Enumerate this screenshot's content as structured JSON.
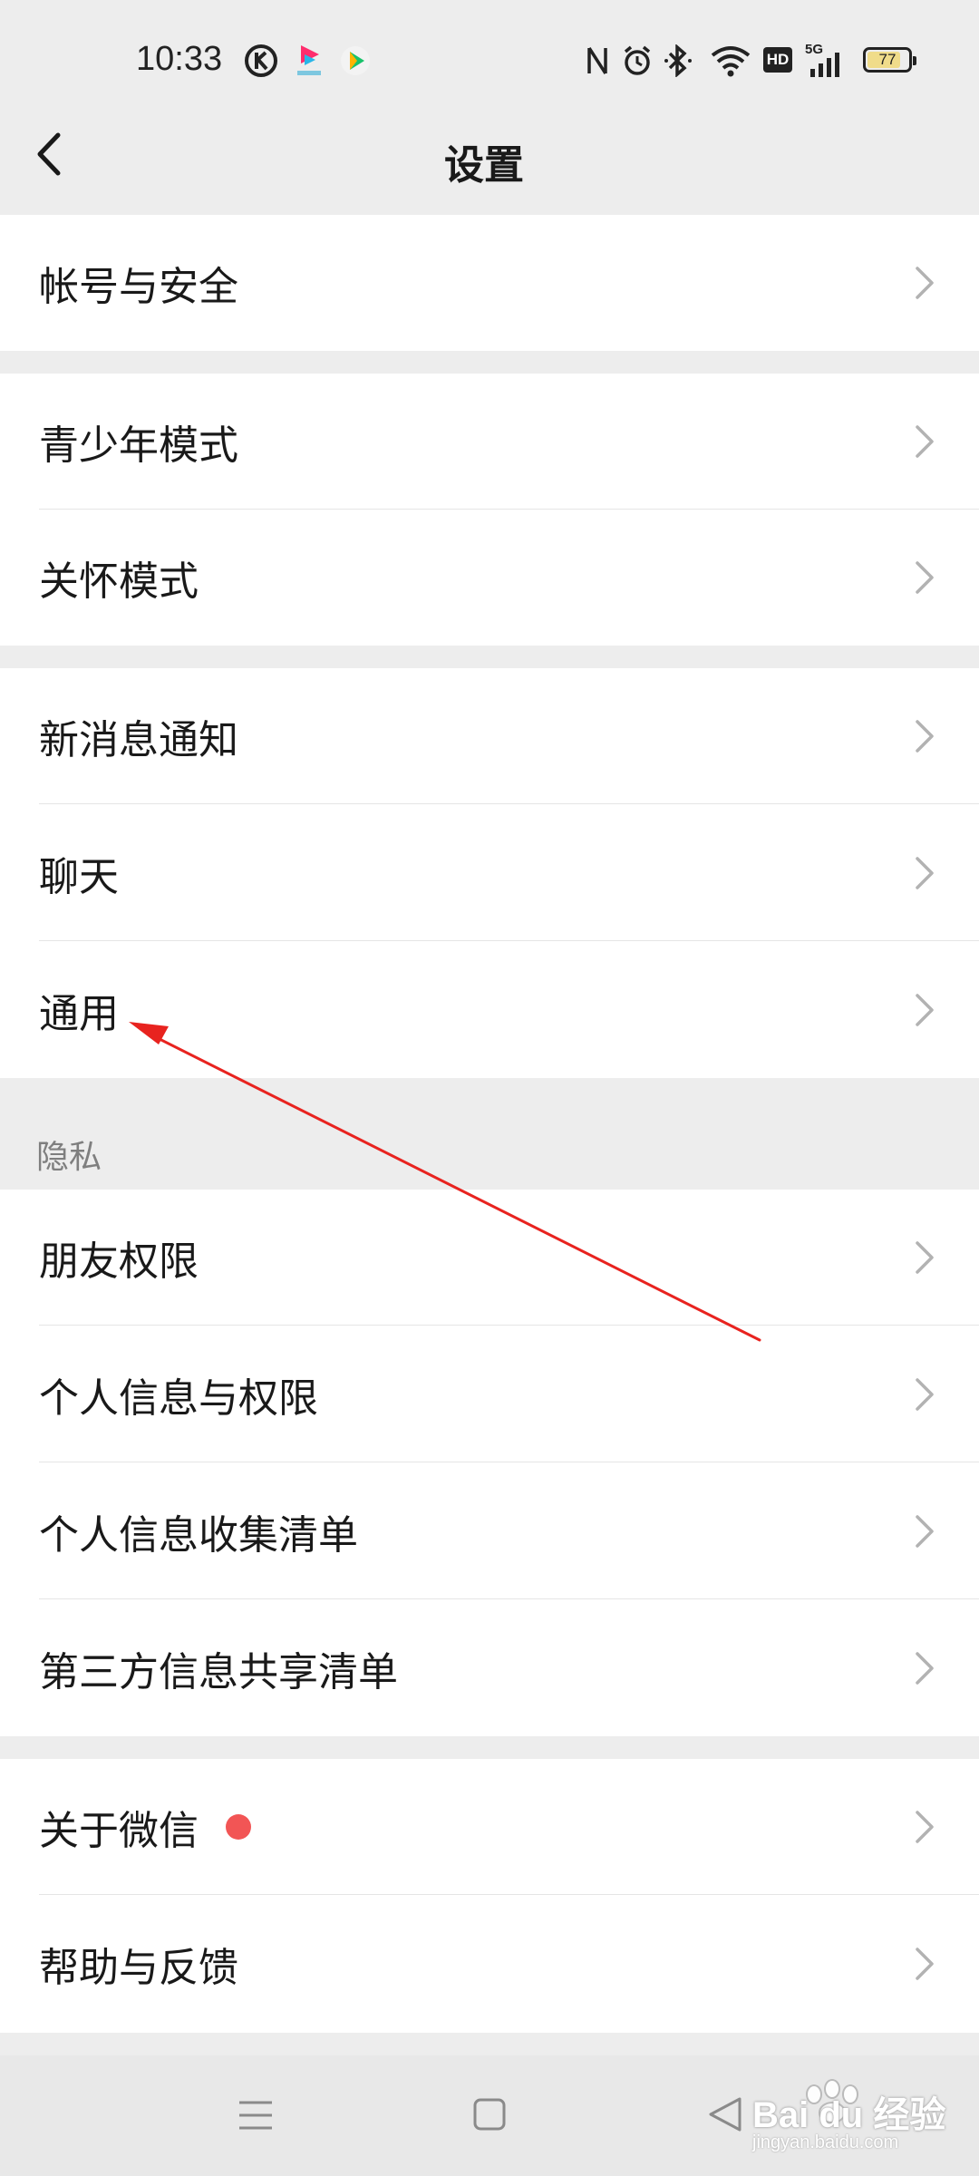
{
  "status_bar": {
    "time": "10:33",
    "battery": "77",
    "network": "5G",
    "hd": "HD",
    "icons": [
      "nfc-icon",
      "alarm-icon",
      "bluetooth-icon",
      "wifi-icon",
      "hd-icon",
      "signal-5g-icon",
      "battery-icon"
    ],
    "app_icons": [
      "k-app-icon",
      "pink-app-icon",
      "play-app-icon"
    ]
  },
  "header": {
    "title": "设置"
  },
  "groups": [
    {
      "items": [
        {
          "label": "帐号与安全"
        }
      ]
    },
    {
      "items": [
        {
          "label": "青少年模式"
        },
        {
          "label": "关怀模式"
        }
      ]
    },
    {
      "items": [
        {
          "label": "新消息通知"
        },
        {
          "label": "聊天"
        },
        {
          "label": "通用"
        }
      ]
    },
    {
      "section_title": "隐私",
      "items": [
        {
          "label": "朋友权限"
        },
        {
          "label": "个人信息与权限"
        },
        {
          "label": "个人信息收集清单"
        },
        {
          "label": "第三方信息共享清单"
        }
      ]
    },
    {
      "items": [
        {
          "label": "关于微信",
          "badge": "red-dot"
        },
        {
          "label": "帮助与反馈"
        }
      ]
    }
  ],
  "annotation": {
    "color": "#e8231f"
  },
  "colors": {
    "background": "#ededed",
    "card": "#ffffff",
    "badge": "#f25555"
  },
  "bottom_nav": {
    "icons": [
      "menu-icon",
      "home-square-icon",
      "back-triangle-icon"
    ]
  },
  "watermark": {
    "text": "Bai du 经验",
    "sub": "jingyan.baidu.com"
  }
}
